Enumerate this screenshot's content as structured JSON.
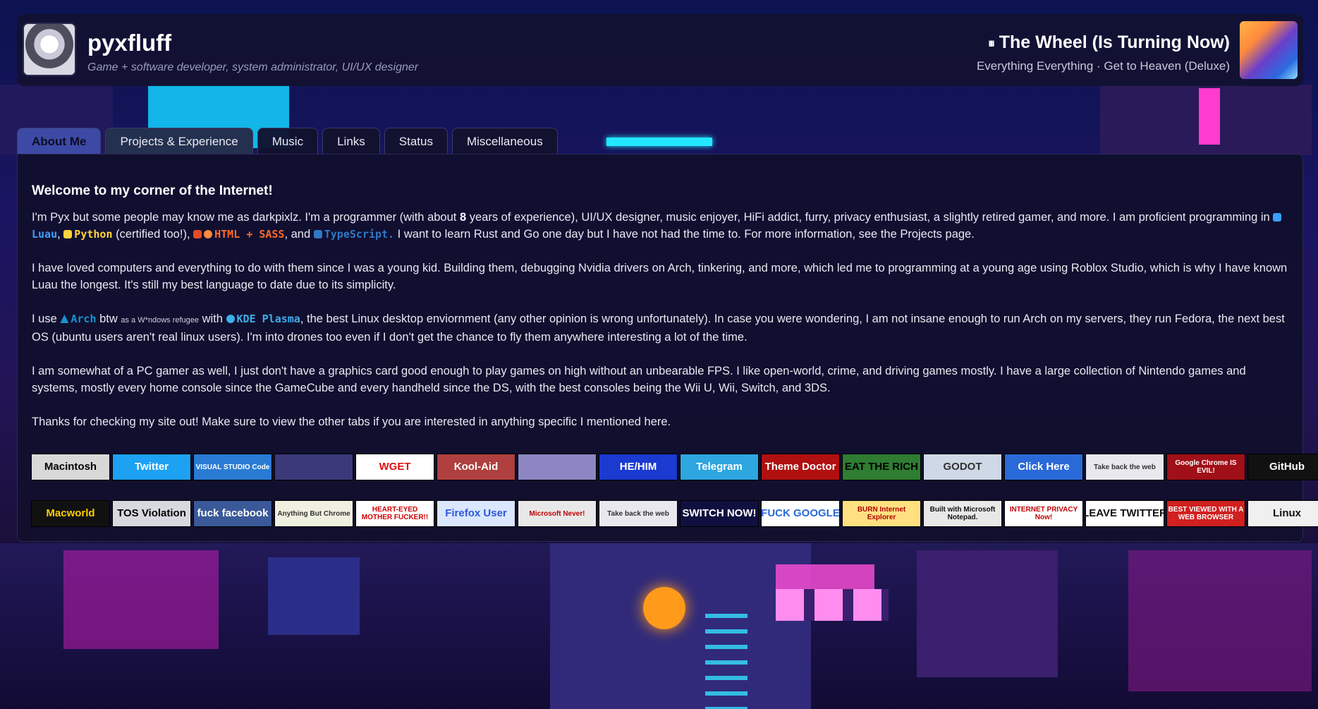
{
  "header": {
    "site_title": "pyxfluff",
    "site_subtitle": "Game + software developer, system administrator, UI/UX designer",
    "now_playing": {
      "title": "The Wheel (Is Turning Now)",
      "bars_icon": "ııı",
      "subtitle": "Everything Everything · Get to Heaven (Deluxe)"
    }
  },
  "tabs": [
    {
      "label": "About Me",
      "active": true
    },
    {
      "label": "Projects & Experience",
      "active": false
    },
    {
      "label": "Music",
      "active": false
    },
    {
      "label": "Links",
      "active": false
    },
    {
      "label": "Status",
      "active": false
    },
    {
      "label": "Miscellaneous",
      "active": false
    }
  ],
  "about": {
    "heading": "Welcome to my corner of the Internet!",
    "p1": {
      "a": "I'm Pyx but some people may know me as darkpixlz. I'm a programmer (with about ",
      "years": "8",
      "b": " years of experience), UI/UX designer, music enjoyer, HiFi addict, furry, privacy enthusiast, a slightly retired gamer, and more. I am proficient programming in ",
      "luau": "Luau",
      "comma1": ", ",
      "python": "Python",
      "certified": " (certified too!), ",
      "html": "HTML + SASS",
      "and": ", and ",
      "ts": "TypeScript.",
      "c": " I want to learn Rust and Go one day but I have not had the time to. For more information, see the Projects page."
    },
    "p2": "I have loved computers and everything to do with them since I was a young kid. Building them, debugging Nvidia drivers on Arch, tinkering, and more, which led me to programming at a young age using Roblox Studio, which is why I have known Luau the longest. It's still my best language to date due to its simplicity.",
    "p3": {
      "a": "I use ",
      "arch": "Arch",
      "btw": " btw ",
      "tiny": "as a W*ndows refugee",
      "with": " with ",
      "kde": "KDE Plasma",
      "b": ", the best Linux desktop enviornment (any other opinion is wrong unfortunately). In case you were wondering, I am not insane enough to run Arch on my servers, they run Fedora, the next best OS (ubuntu users aren't real linux users). I'm into drones too even if I don't get the chance to fly them anywhere interesting a lot of the time."
    },
    "p4": "I am somewhat of a PC gamer as well, I just don't have a graphics card good enough to play games on high without an unbearable FPS. I like open-world, crime, and driving games mostly. I have a large collection of Nintendo games and systems, mostly every home console since the GameCube and every handheld since the DS, with the best consoles being the Wii U, Wii, Switch, and 3DS.",
    "p5": "Thanks for checking my site out! Make sure to view the other tabs if you are interested in anything specific I mentioned here."
  },
  "buttons_row1": [
    {
      "label": "Macintosh",
      "bg": "#d8d8d8",
      "fg": "#000000"
    },
    {
      "label": "Twitter",
      "bg": "#1da1f2",
      "fg": "#ffffff"
    },
    {
      "label": "VISUAL STUDIO Code",
      "bg": "#2a7bd3",
      "fg": "#ffffff"
    },
    {
      "label": "",
      "bg": "#3a3a7a",
      "fg": "#ffffff"
    },
    {
      "label": "WGET",
      "bg": "#ffffff",
      "fg": "#e01010"
    },
    {
      "label": "Kool-Aid",
      "bg": "#b04040",
      "fg": "#ffffff"
    },
    {
      "label": "",
      "bg": "#8c86c4",
      "fg": "#ffffff"
    },
    {
      "label": "HE/HIM",
      "bg": "#1a3ad0",
      "fg": "#ffffff"
    },
    {
      "label": "Telegram",
      "bg": "#2ea6df",
      "fg": "#ffffff"
    },
    {
      "label": "Theme Doctor",
      "bg": "#b01010",
      "fg": "#ffffff"
    },
    {
      "label": "EAT THE RICH",
      "bg": "#2e7d32",
      "fg": "#000000"
    },
    {
      "label": "GODOT",
      "bg": "#cfd8e6",
      "fg": "#333333"
    },
    {
      "label": "Click Here",
      "bg": "#2a6ad8",
      "fg": "#ffffff"
    },
    {
      "label": "Take back the web",
      "bg": "#e8e8ee",
      "fg": "#333333"
    },
    {
      "label": "Google Chrome IS EVIL!",
      "bg": "#a01018",
      "fg": "#ffffff"
    },
    {
      "label": "GitHub",
      "bg": "#111111",
      "fg": "#ffffff"
    }
  ],
  "buttons_row2": [
    {
      "label": "Macworld",
      "bg": "#111111",
      "fg": "#ffcc00"
    },
    {
      "label": "TOS Violation",
      "bg": "#d8d8e0",
      "fg": "#000000"
    },
    {
      "label": "fuck facebook",
      "bg": "#3b5998",
      "fg": "#ffffff"
    },
    {
      "label": "Anything But Chrome",
      "bg": "#f0f0e0",
      "fg": "#333333"
    },
    {
      "label": "HEART-EYED MOTHER FUCKER!!",
      "bg": "#ffffff",
      "fg": "#d00000"
    },
    {
      "label": "Firefox User",
      "bg": "#dbe6ff",
      "fg": "#2a5ad8"
    },
    {
      "label": "Microsoft Never!",
      "bg": "#e8e8e8",
      "fg": "#c00000"
    },
    {
      "label": "Take back the web",
      "bg": "#e8e8ee",
      "fg": "#333333"
    },
    {
      "label": "SWITCH NOW!",
      "bg": "#101040",
      "fg": "#ffffff"
    },
    {
      "label": "FUCK GOOGLE",
      "bg": "#ffffff",
      "fg": "#2a6ad8"
    },
    {
      "label": "BURN Internet Explorer",
      "bg": "#ffe080",
      "fg": "#b00000"
    },
    {
      "label": "Built with Microsoft Notepad.",
      "bg": "#e8e8e8",
      "fg": "#111111"
    },
    {
      "label": "INTERNET PRIVACY Now!",
      "bg": "#ffffff",
      "fg": "#c00000"
    },
    {
      "label": "LEAVE TWITTER",
      "bg": "#ffffff",
      "fg": "#111111"
    },
    {
      "label": "BEST VIEWED WITH A WEB BROWSER",
      "bg": "#d02020",
      "fg": "#ffffff"
    },
    {
      "label": "Linux",
      "bg": "#f0f0f0",
      "fg": "#111111"
    }
  ],
  "icons": {
    "avatar": "avatar-image",
    "now_playing_art": "album-art-image",
    "bars": "equalizer-icon"
  }
}
